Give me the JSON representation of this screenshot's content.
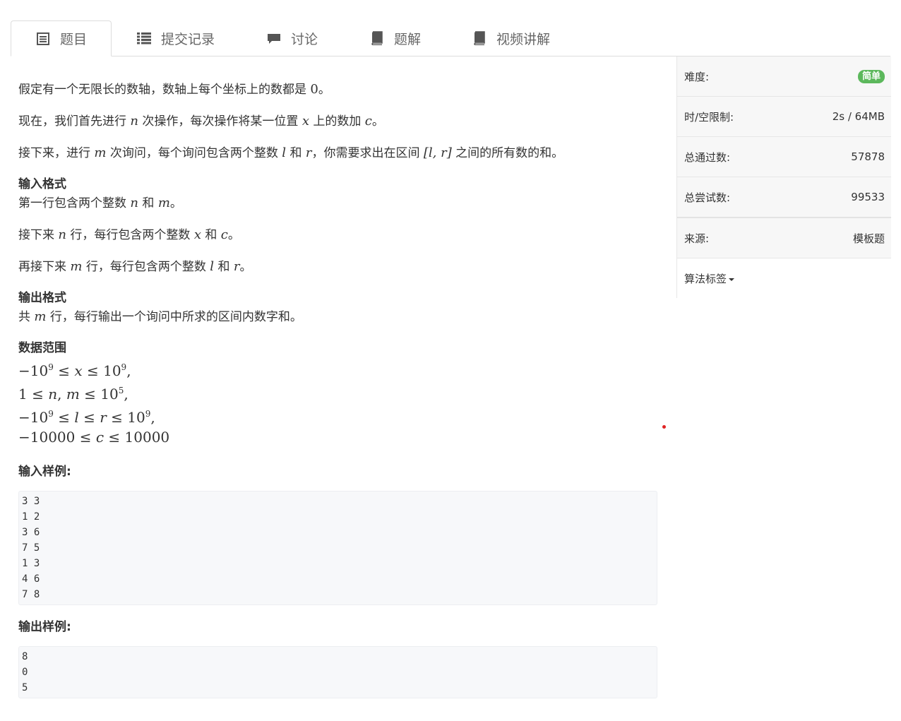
{
  "tabs": [
    {
      "label": "题目",
      "icon": "document-list-icon",
      "active": true
    },
    {
      "label": "提交记录",
      "icon": "list-icon"
    },
    {
      "label": "讨论",
      "icon": "comment-icon"
    },
    {
      "label": "题解",
      "icon": "book-icon"
    },
    {
      "label": "视频讲解",
      "icon": "book-icon"
    }
  ],
  "problem": {
    "p1_a": "假定有一个无限长的数轴，数轴上每个坐标上的数都是 ",
    "p1_zero": "0",
    "p1_b": "。",
    "p2_a": "现在，我们首先进行 ",
    "p2_n": "n",
    "p2_b": " 次操作，每次操作将某一位置 ",
    "p2_x": "x",
    "p2_c": " 上的数加 ",
    "p2_cvar": "c",
    "p2_d": "。",
    "p3_a": "接下来，进行 ",
    "p3_m": "m",
    "p3_b": " 次询问，每个询问包含两个整数 ",
    "p3_l": "l",
    "p3_c": " 和 ",
    "p3_r": "r",
    "p3_d": "，你需要求出在区间 ",
    "p3_interval": "[l, r]",
    "p3_e": " 之间的所有数的和。",
    "input_title": "输入格式",
    "in1_a": "第一行包含两个整数 ",
    "in1_n": "n",
    "in1_b": " 和 ",
    "in1_m": "m",
    "in1_c": "。",
    "in2_a": "接下来 ",
    "in2_n": "n",
    "in2_b": " 行，每行包含两个整数 ",
    "in2_x": "x",
    "in2_c": " 和 ",
    "in2_cvar": "c",
    "in2_d": "。",
    "in3_a": "再接下来 ",
    "in3_m": "m",
    "in3_b": " 行，每行包含两个整数 ",
    "in3_l": "l",
    "in3_c": " 和 ",
    "in3_r": "r",
    "in3_d": "。",
    "output_title": "输出格式",
    "out1_a": "共 ",
    "out1_m": "m",
    "out1_b": " 行，每行输出一个询问中所求的区间内数字和。",
    "range_title": "数据范围",
    "sample_in_title": "输入样例:",
    "sample_in": "3 3\n1 2\n3 6\n7 5\n1 3\n4 6\n7 8",
    "sample_out_title": "输出样例:",
    "sample_out": "8\n0\n5"
  },
  "sidebar": {
    "difficulty_label": "难度:",
    "difficulty_value": "简单",
    "limit_label": "时/空限制:",
    "limit_value": "2s / 64MB",
    "passed_label": "总通过数:",
    "passed_value": "57878",
    "tried_label": "总尝试数:",
    "tried_value": "99533",
    "source_label": "来源:",
    "source_value": "模板题",
    "tags_label": "算法标签"
  },
  "colors": {
    "badge": "#5cb85c",
    "marker": "#e02424"
  }
}
